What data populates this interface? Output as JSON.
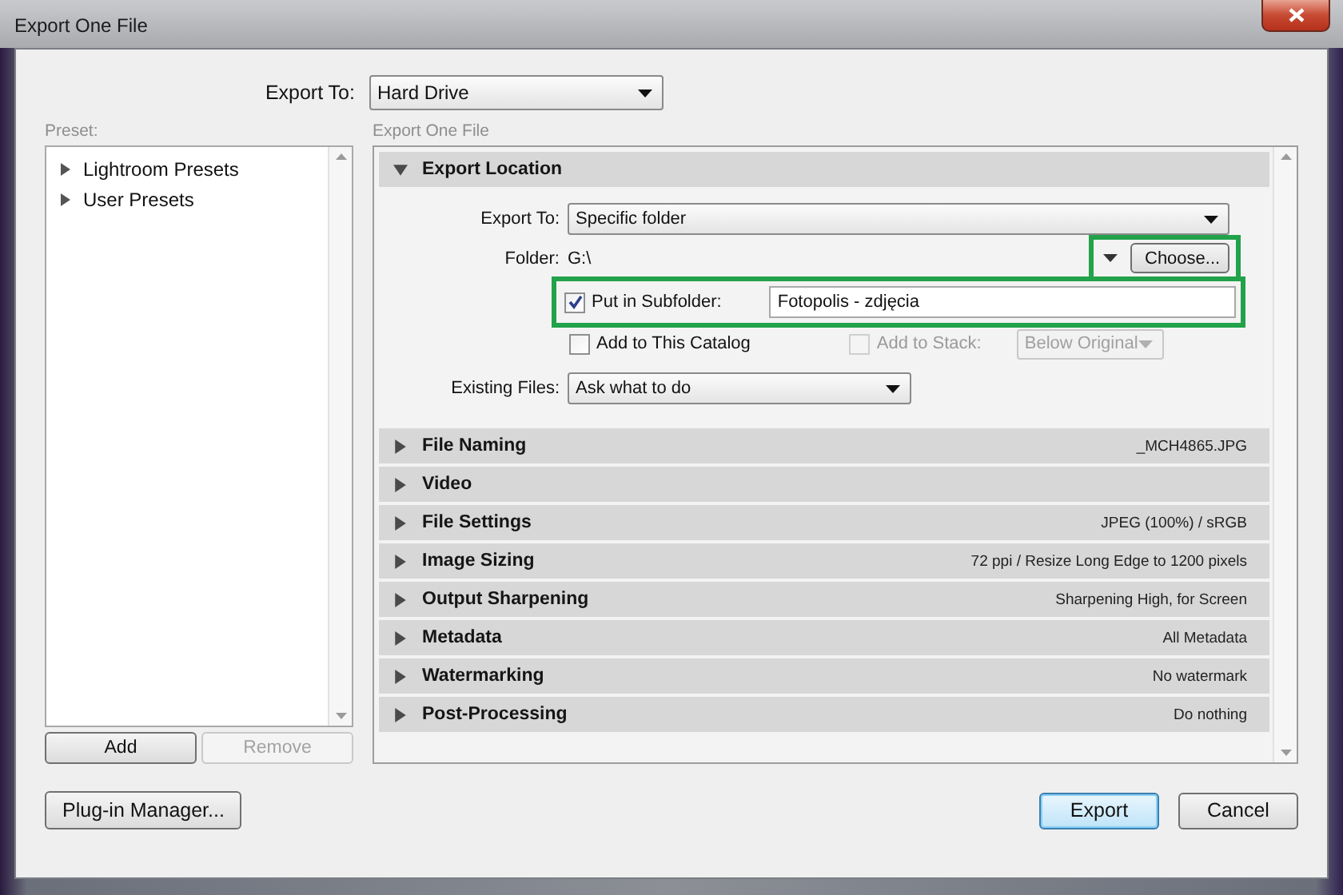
{
  "window": {
    "title": "Export One File"
  },
  "export_to": {
    "label": "Export To:",
    "value": "Hard Drive"
  },
  "preset": {
    "label": "Preset:",
    "items": [
      {
        "label": "Lightroom Presets",
        "expanded": false
      },
      {
        "label": "User Presets",
        "expanded": false
      }
    ],
    "buttons": [
      {
        "label": "Add",
        "disabled": false
      },
      {
        "label": "Remove",
        "disabled": true
      }
    ]
  },
  "settings": {
    "label": "Export One File",
    "sections": [
      {
        "title": "Export Location",
        "expanded": true,
        "content": {
          "export_to": {
            "label": "Export To:",
            "value": "Specific folder"
          },
          "folder": {
            "label": "Folder:",
            "value": "G:\\",
            "button": "Choose...",
            "highlighted": true
          },
          "subfolder": {
            "label": "Put in Subfolder:",
            "checked": true,
            "value": "Fotopolis - zdjęcia",
            "highlighted": true
          },
          "add_to_catalog": {
            "label": "Add to This Catalog",
            "checked": false
          },
          "add_to_stack": {
            "label": "Add to Stack:",
            "checked": false,
            "disabled": true,
            "value": "Below Original"
          },
          "existing_files": {
            "label": "Existing Files:",
            "value": "Ask what to do"
          }
        }
      },
      {
        "title": "File Naming",
        "expanded": false,
        "summary": "_MCH4865.JPG"
      },
      {
        "title": "Video",
        "expanded": false
      },
      {
        "title": "File Settings",
        "expanded": false,
        "summary": "JPEG (100%) / sRGB"
      },
      {
        "title": "Image Sizing",
        "expanded": false,
        "summary": "72 ppi / Resize Long Edge to 1200 pixels"
      },
      {
        "title": "Output Sharpening",
        "expanded": false,
        "summary": "Sharpening High, for Screen"
      },
      {
        "title": "Metadata",
        "expanded": false,
        "summary": "All Metadata"
      },
      {
        "title": "Watermarking",
        "expanded": false,
        "summary": "No watermark"
      },
      {
        "title": "Post-Processing",
        "expanded": false,
        "summary": "Do nothing"
      }
    ]
  },
  "plugin_manager": "Plug-in Manager...",
  "actions": [
    {
      "label": "Export",
      "default": true
    },
    {
      "label": "Cancel",
      "default": false
    }
  ]
}
